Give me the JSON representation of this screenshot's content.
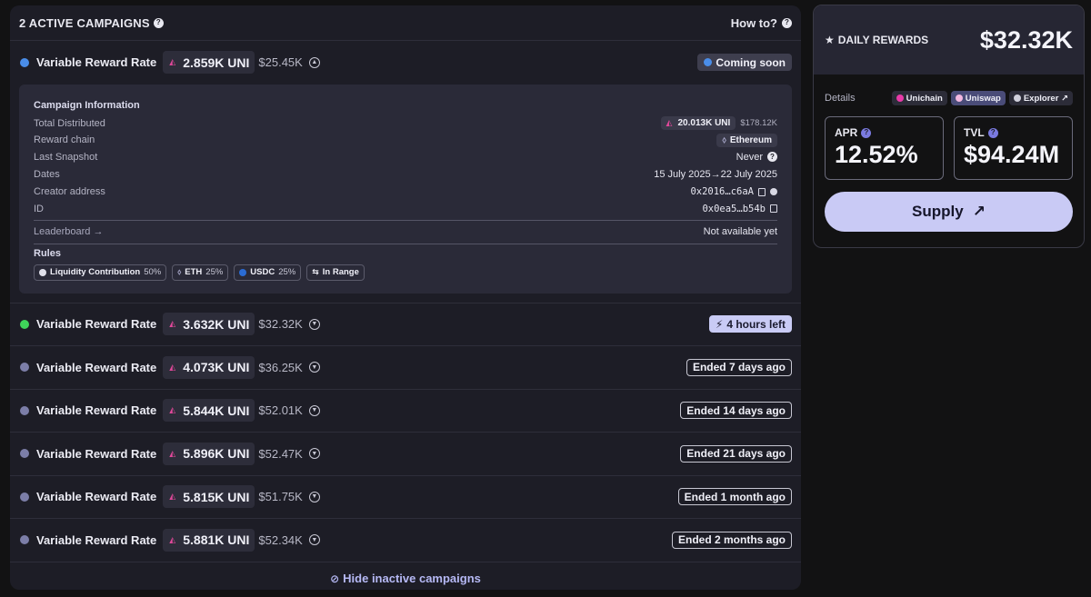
{
  "campaigns": {
    "title": "2 ACTIVE CAMPAIGNS",
    "howto": "How to?",
    "hide_label": "Hide inactive campaigns",
    "rows": [
      {
        "label": "Variable Reward Rate",
        "amount": "2.859K UNI",
        "usd": "$25.45K",
        "status": "Coming soon",
        "dot": "#4a8de8"
      },
      {
        "label": "Variable Reward Rate",
        "amount": "3.632K UNI",
        "usd": "$32.32K",
        "status": "4 hours left",
        "dot": "#3fd45a"
      },
      {
        "label": "Variable Reward Rate",
        "amount": "4.073K UNI",
        "usd": "$36.25K",
        "status": "Ended 7 days ago",
        "dot": "#7c7ea8"
      },
      {
        "label": "Variable Reward Rate",
        "amount": "5.844K UNI",
        "usd": "$52.01K",
        "status": "Ended 14 days ago",
        "dot": "#7c7ea8"
      },
      {
        "label": "Variable Reward Rate",
        "amount": "5.896K UNI",
        "usd": "$52.47K",
        "status": "Ended 21 days ago",
        "dot": "#7c7ea8"
      },
      {
        "label": "Variable Reward Rate",
        "amount": "5.815K UNI",
        "usd": "$51.75K",
        "status": "Ended 1 month ago",
        "dot": "#7c7ea8"
      },
      {
        "label": "Variable Reward Rate",
        "amount": "5.881K UNI",
        "usd": "$52.34K",
        "status": "Ended 2 months ago",
        "dot": "#7c7ea8"
      }
    ],
    "info": {
      "title": "Campaign Information",
      "total_distributed_label": "Total Distributed",
      "total_distributed_amount": "20.013K UNI",
      "total_distributed_usd": "$178.12K",
      "reward_chain_label": "Reward chain",
      "reward_chain_value": "Ethereum",
      "last_snapshot_label": "Last Snapshot",
      "last_snapshot_value": "Never",
      "dates_label": "Dates",
      "dates_value": "15 July 2025→22 July 2025",
      "creator_label": "Creator address",
      "creator_value": "0x2016…c6aA",
      "id_label": "ID",
      "id_value": "0x0ea5…b54b",
      "leaderboard_label": "Leaderboard →",
      "leaderboard_value": "Not available yet",
      "rules_label": "Rules",
      "rules": [
        {
          "name": "Liquidity Contribution",
          "pct": "50%",
          "icon": "droplet-icon"
        },
        {
          "name": "ETH",
          "pct": "25%",
          "icon": "eth-icon"
        },
        {
          "name": "USDC",
          "pct": "25%",
          "icon": "usdc-icon"
        },
        {
          "name": "In Range",
          "pct": "",
          "icon": "range-icon"
        }
      ]
    }
  },
  "rewards": {
    "label": "DAILY REWARDS",
    "value": "$32.32K",
    "details_label": "Details",
    "chips": [
      "Unichain",
      "Uniswap",
      "Explorer ↗"
    ],
    "apr_label": "APR",
    "apr_value": "12.52%",
    "tvl_label": "TVL",
    "tvl_value": "$94.24M",
    "supply_label": "Supply",
    "supply_icon": "↗"
  },
  "colors": {
    "accent": "#c9caf5",
    "panel": "#1d1d26",
    "uni": "#e0489a"
  }
}
